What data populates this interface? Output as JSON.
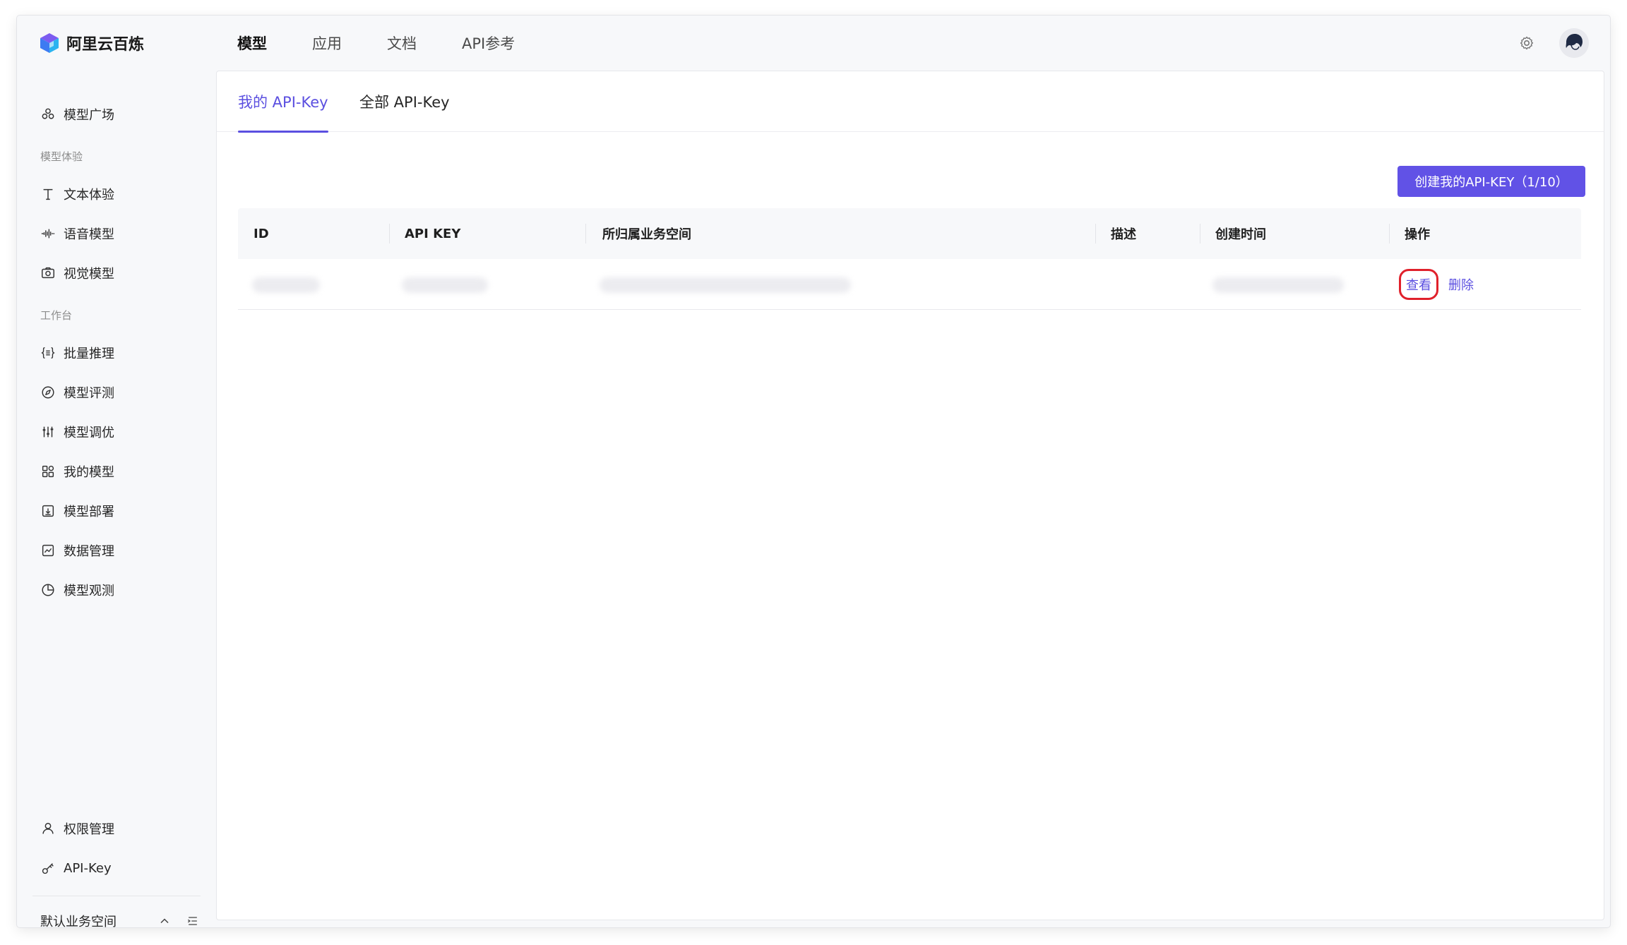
{
  "app": {
    "logo_text": "阿里云百炼"
  },
  "topnav": [
    {
      "label": "模型",
      "active": true
    },
    {
      "label": "应用",
      "active": false
    },
    {
      "label": "文档",
      "active": false
    },
    {
      "label": "API参考",
      "active": false
    }
  ],
  "sidebar": {
    "model_square": "模型广场",
    "group_experience": "模型体验",
    "text_experience": "文本体验",
    "voice_model": "语音模型",
    "vision_model": "视觉模型",
    "group_workbench": "工作台",
    "batch_inference": "批量推理",
    "model_eval": "模型评测",
    "model_tuning": "模型调优",
    "my_models": "我的模型",
    "model_deploy": "模型部署",
    "data_manage": "数据管理",
    "model_observe": "模型观测",
    "permission_manage": "权限管理",
    "api_key": "API-Key",
    "workspace": "默认业务空间"
  },
  "tabs": [
    {
      "label": "我的 API-Key",
      "active": true
    },
    {
      "label": "全部 API-Key",
      "active": false
    }
  ],
  "create_button": "创建我的API-KEY（1/10）",
  "table": {
    "headers": {
      "id": "ID",
      "api_key": "API KEY",
      "workspace": "所归属业务空间",
      "desc": "描述",
      "created": "创建时间",
      "ops": "操作"
    },
    "row_actions": {
      "view": "查看",
      "delete": "删除"
    }
  },
  "colors": {
    "accent": "#5b4fe0",
    "button": "#6152e6",
    "highlight": "#e0212b"
  }
}
